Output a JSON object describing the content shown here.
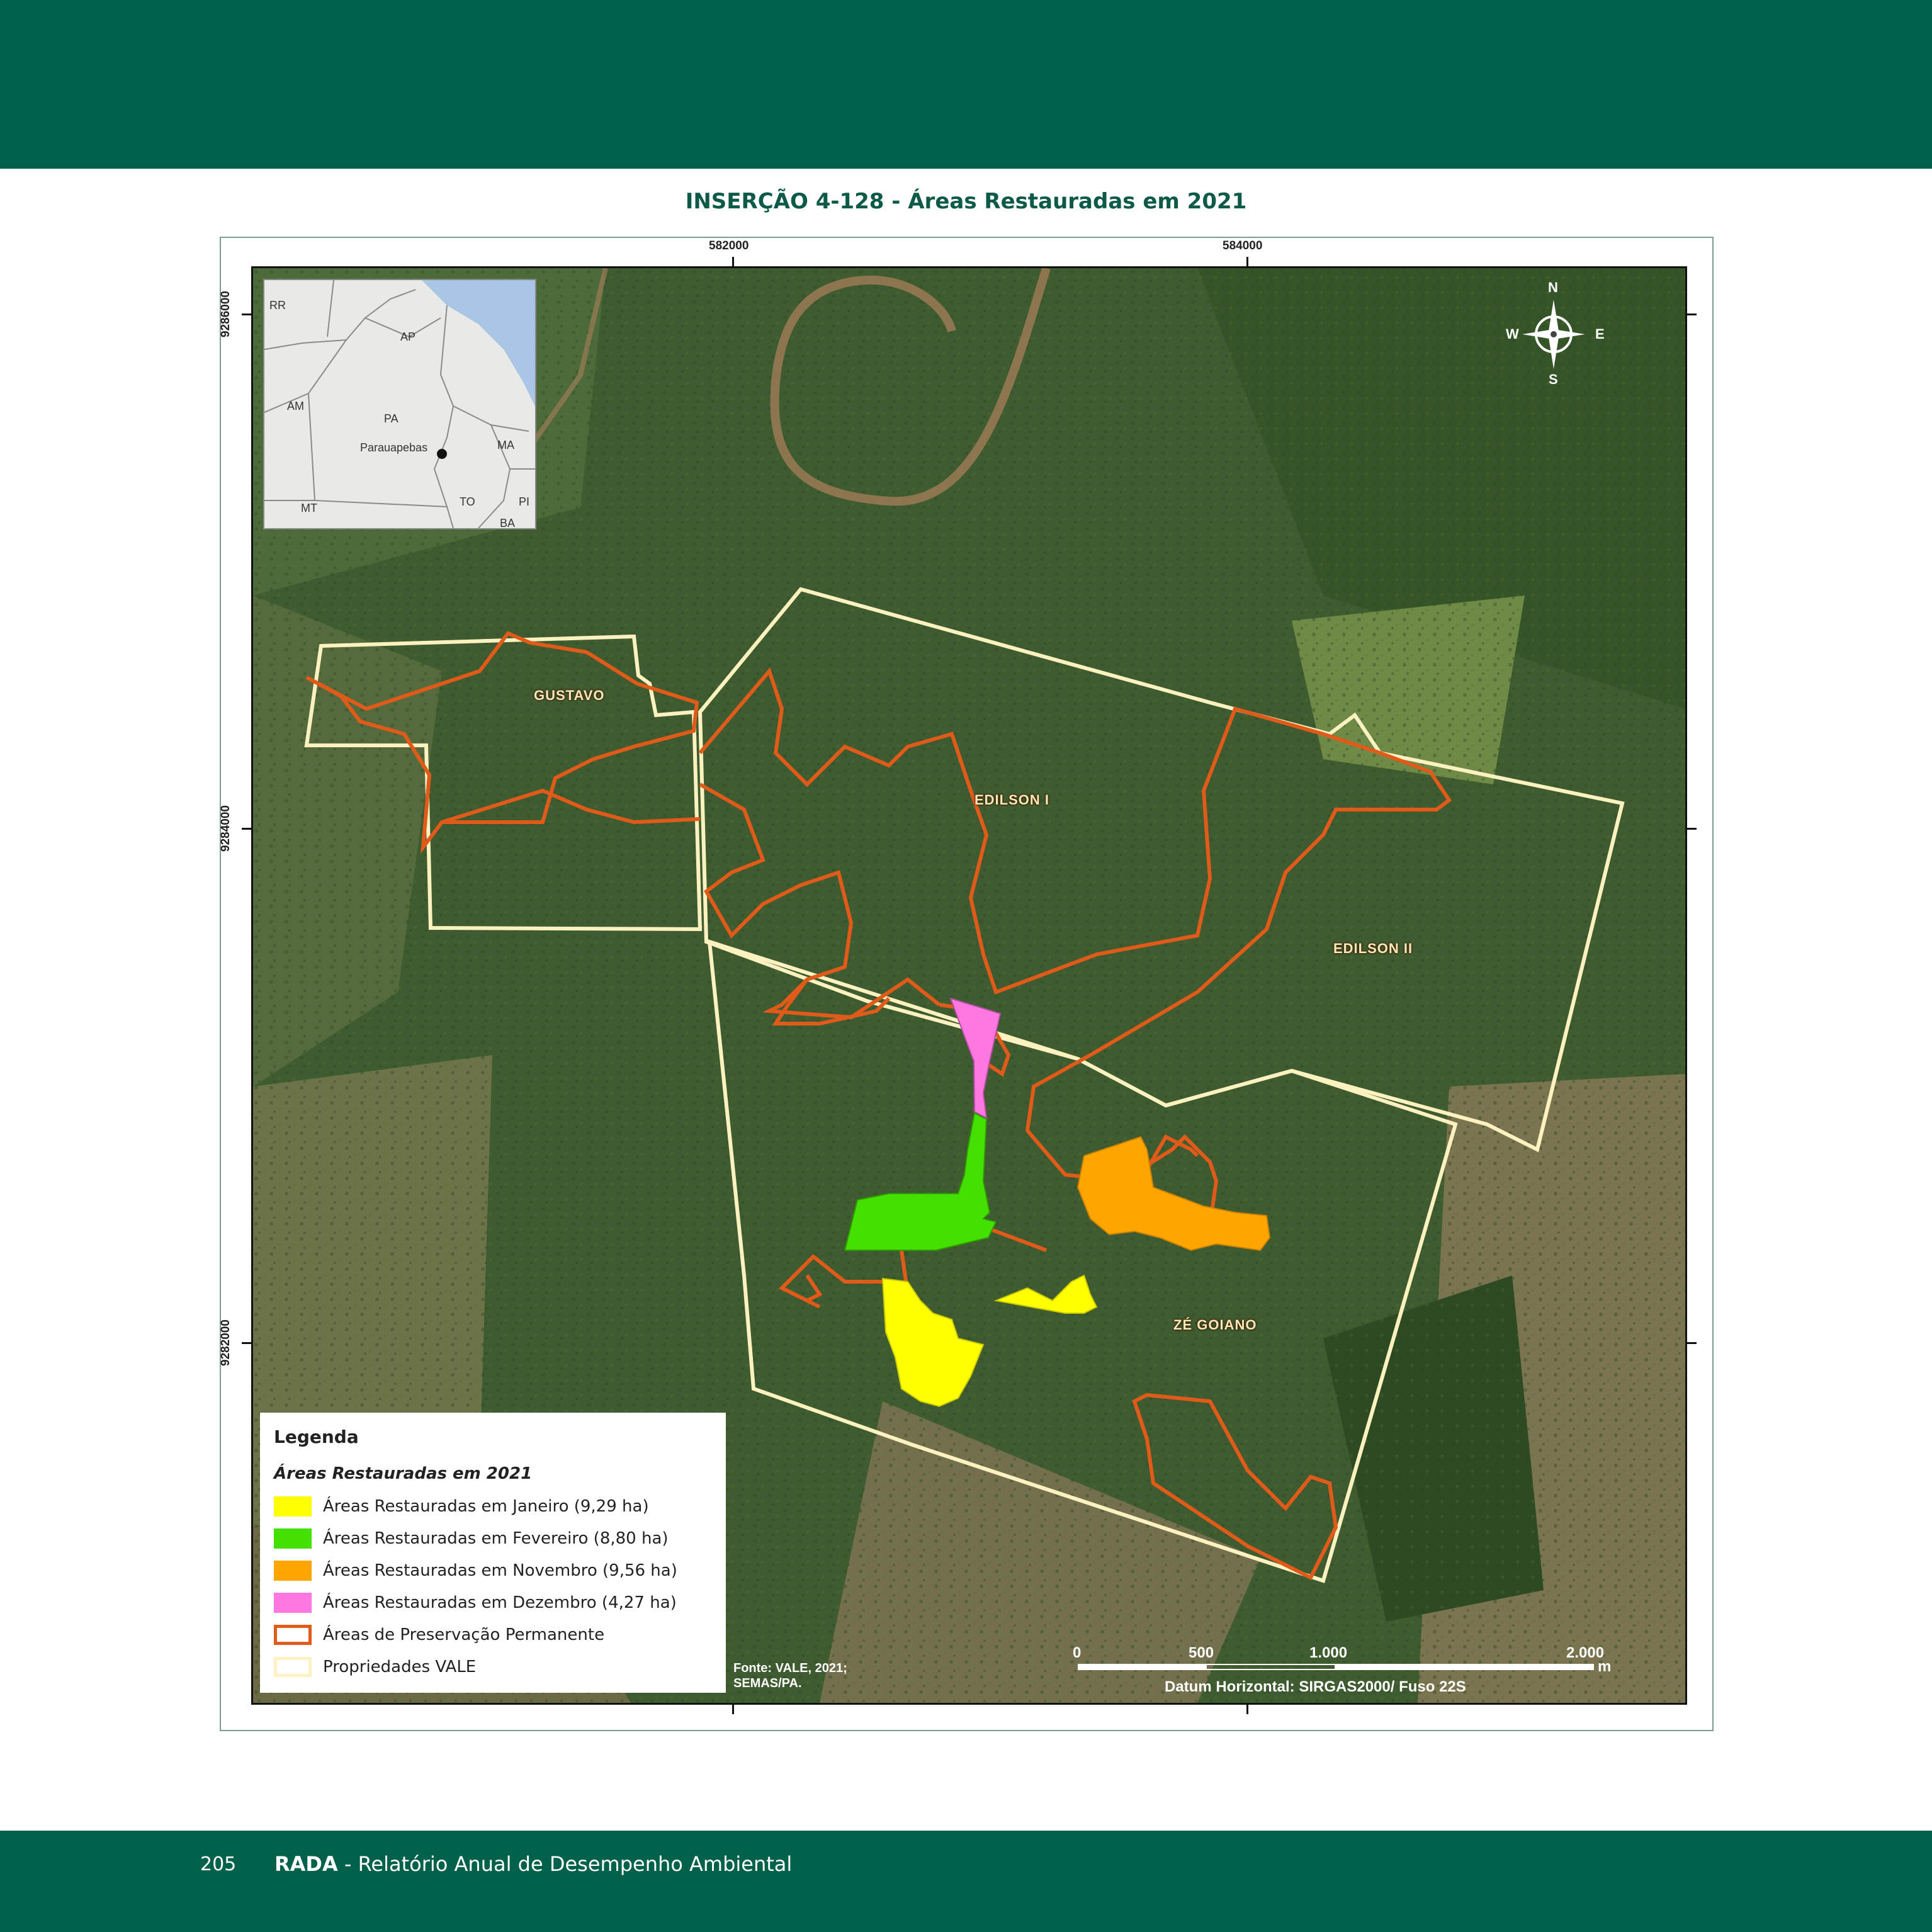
{
  "header": {
    "title": "INSERÇÃO 4-128 - Áreas Restauradas em 2021"
  },
  "map": {
    "coords_top": [
      "582000",
      "584000"
    ],
    "coords_left": [
      "9286000",
      "9284000",
      "9282000"
    ],
    "inset": {
      "labels": [
        "RR",
        "AP",
        "AM",
        "PA",
        "MA",
        "MT",
        "TO",
        "PI",
        "BA"
      ],
      "city": "Parauapebas"
    },
    "compass": {
      "n": "N",
      "s": "S",
      "e": "E",
      "w": "W",
      "icon": "compass-rose-icon"
    },
    "properties": [
      "GUSTAVO",
      "EDILSON I",
      "EDILSON II",
      "ZÉ GOIANO"
    ],
    "scale": {
      "ticks": [
        "0",
        "500",
        "1.000",
        "2.000"
      ],
      "unit": "m"
    },
    "datum": "Datum Horizontal: SIRGAS2000/ Fuso 22S",
    "source_line1": "Fonte: VALE, 2021;",
    "source_line2": "SEMAS/PA."
  },
  "legend": {
    "title": "Legenda",
    "subtitle": "Áreas Restauradas em 2021",
    "items": [
      {
        "label": "Áreas Restauradas em Janeiro (9,29 ha)",
        "color": "#ffff00"
      },
      {
        "label": "Áreas Restauradas em Fevereiro (8,80 ha)",
        "color": "#44e000"
      },
      {
        "label": "Áreas Restauradas em Novembro (9,56 ha)",
        "color": "#ffa500"
      },
      {
        "label": "Áreas Restauradas em Dezembro (4,27 ha)",
        "color": "#ff77e0"
      },
      {
        "label": "Áreas de Preservação Permanente",
        "color": "#e05a1a"
      },
      {
        "label": "Propriedades VALE",
        "color": "#fff2c0"
      }
    ]
  },
  "footer": {
    "page_number": "205",
    "brand": "RADA",
    "text": " - Relatório Anual de Desempenho Ambiental"
  }
}
